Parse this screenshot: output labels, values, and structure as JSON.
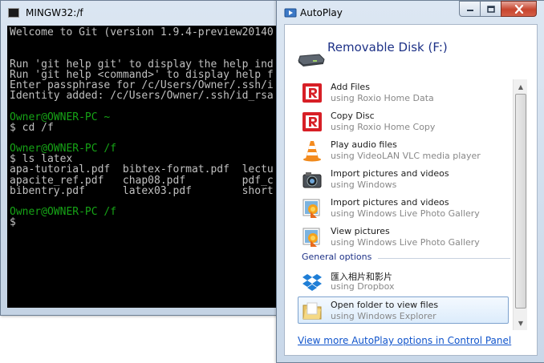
{
  "terminal": {
    "title": "MINGW32:/f",
    "lines": [
      {
        "text": "Welcome to Git (version 1.9.4-preview20140",
        "color": "white"
      },
      {
        "text": "",
        "color": "white"
      },
      {
        "text": "",
        "color": "white"
      },
      {
        "text": "Run 'git help git' to display the help ind",
        "color": "white"
      },
      {
        "text": "Run 'git help <command>' to display help f",
        "color": "white"
      },
      {
        "text": "Enter passphrase for /c/Users/Owner/.ssh/i",
        "color": "white"
      },
      {
        "text": "Identity added: /c/Users/Owner/.ssh/id_rsa",
        "color": "white"
      },
      {
        "text": "",
        "color": "white"
      },
      {
        "text": "Owner@OWNER-PC ~",
        "color": "green"
      },
      {
        "text": "$ cd /f",
        "color": "white"
      },
      {
        "text": "",
        "color": "white"
      },
      {
        "text": "Owner@OWNER-PC /f",
        "color": "green"
      },
      {
        "text": "$ ls latex",
        "color": "white"
      },
      {
        "text": "apa-tutorial.pdf  bibtex-format.pdf  lectu",
        "color": "white"
      },
      {
        "text": "apacite_ref.pdf   chap08.pdf         pdf_c",
        "color": "white"
      },
      {
        "text": "bibentry.pdf      latex03.pdf        short",
        "color": "white"
      },
      {
        "text": "",
        "color": "white"
      },
      {
        "text": "Owner@OWNER-PC /f",
        "color": "green"
      },
      {
        "text": "$",
        "color": "white"
      }
    ]
  },
  "autoplay": {
    "title": "AutoPlay",
    "drive_title": "Removable Disk (F:)",
    "items": [
      {
        "title": "Add Files",
        "subtitle": "using Roxio Home Data",
        "icon": "roxio-icon"
      },
      {
        "title": "Copy Disc",
        "subtitle": "using Roxio Home Copy",
        "icon": "roxio-icon"
      },
      {
        "title": "Play audio files",
        "subtitle": "using VideoLAN VLC media player",
        "icon": "vlc-icon"
      },
      {
        "title": "Import pictures and videos",
        "subtitle": "using Windows",
        "icon": "camera-icon"
      },
      {
        "title": "Import pictures and videos",
        "subtitle": "using Windows Live Photo Gallery",
        "icon": "photo-gallery-icon"
      },
      {
        "title": "View pictures",
        "subtitle": "using Windows Live Photo Gallery",
        "icon": "photo-gallery-icon"
      }
    ],
    "general_options_label": "General options",
    "general_items": [
      {
        "title": "匯入相片和影片",
        "subtitle": "using Dropbox",
        "icon": "dropbox-icon"
      },
      {
        "title": "Open folder to view files",
        "subtitle": "using Windows Explorer",
        "icon": "folder-icon",
        "selected": true
      }
    ],
    "footer_link": "View more AutoPlay options in Control Panel"
  },
  "colors": {
    "terminal_text": "#c0c0c0",
    "terminal_prompt": "#16a316",
    "link": "#1155cc",
    "heading": "#1e3287",
    "selection_border": "#7da2ce"
  }
}
